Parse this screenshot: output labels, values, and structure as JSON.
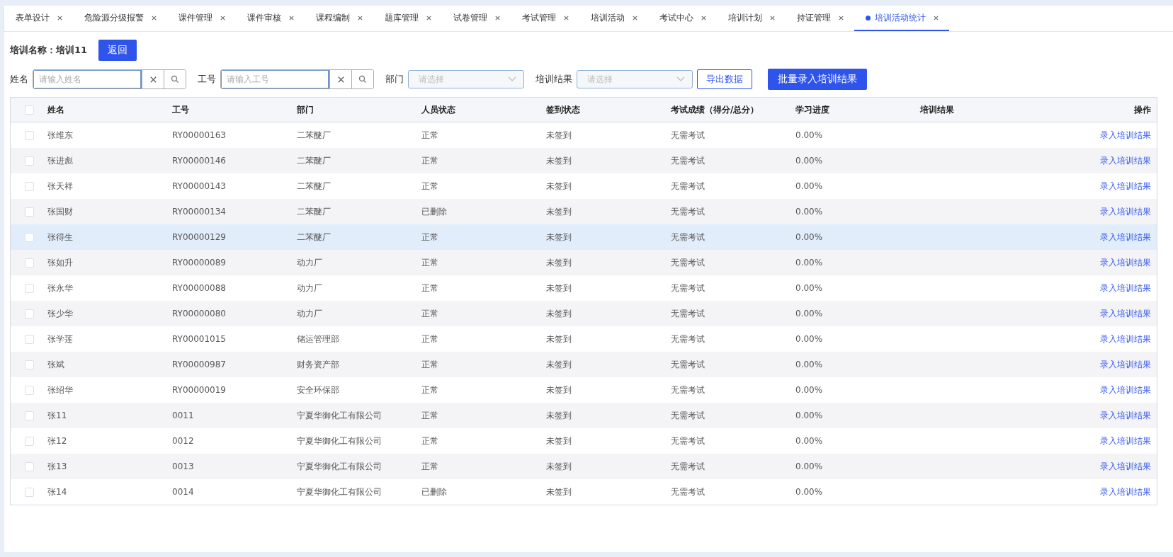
{
  "tabs": [
    {
      "label": "表单设计",
      "selected": false
    },
    {
      "label": "危险源分级报警",
      "selected": false
    },
    {
      "label": "课件管理",
      "selected": false
    },
    {
      "label": "课件审核",
      "selected": false
    },
    {
      "label": "课程编制",
      "selected": false
    },
    {
      "label": "题库管理",
      "selected": false
    },
    {
      "label": "试卷管理",
      "selected": false
    },
    {
      "label": "考试管理",
      "selected": false
    },
    {
      "label": "培训活动",
      "selected": false
    },
    {
      "label": "考试中心",
      "selected": false
    },
    {
      "label": "培训计划",
      "selected": false
    },
    {
      "label": "持证管理",
      "selected": false
    },
    {
      "label": "培训活动统计",
      "selected": true
    }
  ],
  "training": {
    "label": "培训名称：",
    "value": "培训11",
    "back_button": "返回"
  },
  "filters": [
    {
      "kind": "search",
      "label": "姓名",
      "placeholder": "请输入姓名"
    },
    {
      "kind": "search",
      "label": "工号",
      "placeholder": "请输入工号"
    },
    {
      "kind": "select",
      "label": "部门",
      "placeholder": "请选择"
    },
    {
      "kind": "select",
      "label": "培训结果",
      "placeholder": "请选择"
    }
  ],
  "export_button": "导出数据",
  "batch_button": "批量录入培训结果",
  "table": {
    "all_checked": false,
    "columns": [
      "姓名",
      "工号",
      "部门",
      "人员状态",
      "签到状态",
      "考试成绩（得分/总分）",
      "学习进度",
      "培训结果",
      "操作"
    ],
    "rows": [
      {
        "name": "张维东",
        "id": "RY00000163",
        "dept": "二苯醚厂",
        "status": "正常",
        "sign": "未签到",
        "score": "无需考试",
        "progress": "0.00%",
        "action": "录入培训结果",
        "highlighted": false,
        "checked": false
      },
      {
        "name": "张进彪",
        "id": "RY00000146",
        "dept": "二苯醚厂",
        "status": "正常",
        "sign": "未签到",
        "score": "无需考试",
        "progress": "0.00%",
        "action": "录入培训结果",
        "highlighted": false,
        "checked": false
      },
      {
        "name": "张天祥",
        "id": "RY00000143",
        "dept": "二苯醚厂",
        "status": "正常",
        "sign": "未签到",
        "score": "无需考试",
        "progress": "0.00%",
        "action": "录入培训结果",
        "highlighted": false,
        "checked": false
      },
      {
        "name": "张国财",
        "id": "RY00000134",
        "dept": "二苯醚厂",
        "status": "已删除",
        "sign": "未签到",
        "score": "无需考试",
        "progress": "0.00%",
        "action": "录入培训结果",
        "highlighted": false,
        "checked": false
      },
      {
        "name": "张得生",
        "id": "RY00000129",
        "dept": "二苯醚厂",
        "status": "正常",
        "sign": "未签到",
        "score": "无需考试",
        "progress": "0.00%",
        "action": "录入培训结果",
        "highlighted": true,
        "checked": false
      },
      {
        "name": "张如升",
        "id": "RY00000089",
        "dept": "动力厂",
        "status": "正常",
        "sign": "未签到",
        "score": "无需考试",
        "progress": "0.00%",
        "action": "录入培训结果",
        "highlighted": false,
        "checked": false
      },
      {
        "name": "张永华",
        "id": "RY00000088",
        "dept": "动力厂",
        "status": "正常",
        "sign": "未签到",
        "score": "无需考试",
        "progress": "0.00%",
        "action": "录入培训结果",
        "highlighted": false,
        "checked": false
      },
      {
        "name": "张少华",
        "id": "RY00000080",
        "dept": "动力厂",
        "status": "正常",
        "sign": "未签到",
        "score": "无需考试",
        "progress": "0.00%",
        "action": "录入培训结果",
        "highlighted": false,
        "checked": false
      },
      {
        "name": "张学莲",
        "id": "RY00001015",
        "dept": "储运管理部",
        "status": "正常",
        "sign": "未签到",
        "score": "无需考试",
        "progress": "0.00%",
        "action": "录入培训结果",
        "highlighted": false,
        "checked": false
      },
      {
        "name": "张斌",
        "id": "RY00000987",
        "dept": "财务资产部",
        "status": "正常",
        "sign": "未签到",
        "score": "无需考试",
        "progress": "0.00%",
        "action": "录入培训结果",
        "highlighted": false,
        "checked": false
      },
      {
        "name": "张绍华",
        "id": "RY00000019",
        "dept": "安全环保部",
        "status": "正常",
        "sign": "未签到",
        "score": "无需考试",
        "progress": "0.00%",
        "action": "录入培训结果",
        "highlighted": false,
        "checked": false
      },
      {
        "name": "张11",
        "id": "0011",
        "dept": "宁夏华御化工有限公司",
        "status": "正常",
        "sign": "未签到",
        "score": "无需考试",
        "progress": "0.00%",
        "action": "录入培训结果",
        "highlighted": false,
        "checked": false
      },
      {
        "name": "张12",
        "id": "0012",
        "dept": "宁夏华御化工有限公司",
        "status": "正常",
        "sign": "未签到",
        "score": "无需考试",
        "progress": "0.00%",
        "action": "录入培训结果",
        "highlighted": false,
        "checked": false
      },
      {
        "name": "张13",
        "id": "0013",
        "dept": "宁夏华御化工有限公司",
        "status": "正常",
        "sign": "未签到",
        "score": "无需考试",
        "progress": "0.00%",
        "action": "录入培训结果",
        "highlighted": false,
        "checked": false
      },
      {
        "name": "张14",
        "id": "0014",
        "dept": "宁夏华御化工有限公司",
        "status": "已删除",
        "sign": "未签到",
        "score": "无需考试",
        "progress": "0.00%",
        "action": "录入培训结果",
        "highlighted": false,
        "checked": false
      }
    ]
  }
}
